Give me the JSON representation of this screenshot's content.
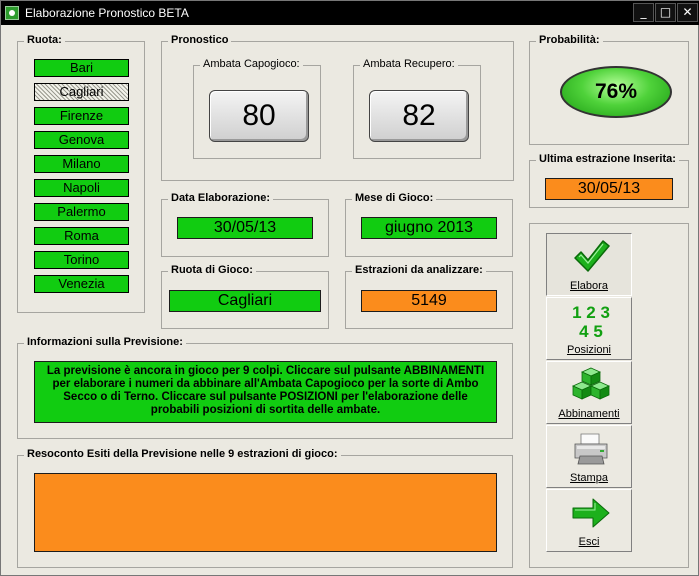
{
  "window": {
    "title": "Elaborazione Pronostico BETA",
    "minimize": "_",
    "maximize": "□",
    "close": "✕"
  },
  "ruota": {
    "legend": "Ruota:",
    "selected": "Cagliari",
    "items": [
      "Bari",
      "Cagliari",
      "Firenze",
      "Genova",
      "Milano",
      "Napoli",
      "Palermo",
      "Roma",
      "Torino",
      "Venezia"
    ]
  },
  "pronostico": {
    "legend": "Pronostico",
    "capogioco": {
      "legend": "Ambata Capogioco:",
      "value": "80"
    },
    "recupero": {
      "legend": "Ambata Recupero:",
      "value": "82"
    }
  },
  "data_elaborazione": {
    "legend": "Data Elaborazione:",
    "value": "30/05/13"
  },
  "mese_gioco": {
    "legend": "Mese di Gioco:",
    "value": "giugno 2013"
  },
  "ruota_gioco": {
    "legend": "Ruota di Gioco:",
    "value": "Cagliari"
  },
  "estrazioni": {
    "legend": "Estrazioni da analizzare:",
    "value": "5149"
  },
  "probabilita": {
    "legend": "Probabilità:",
    "value": "76%"
  },
  "ultima_estrazione": {
    "legend": "Ultima estrazione Inserita:",
    "value": "30/05/13"
  },
  "informazioni": {
    "legend": "Informazioni sulla Previsione:",
    "lines": [
      "La previsione è ancora in gioco per 9 colpi. Cliccare sul pulsante ABBINAMENTI",
      "per elaborare i numeri da abbinare all'Ambata Capogioco per la sorte di Ambo",
      "Secco o di Terno. Cliccare sul pulsante POSIZIONI per l'elaborazione delle",
      "probabili posizioni di sortita delle ambate."
    ]
  },
  "resoconto": {
    "legend": "Resoconto Esiti della Previsione nelle 9 estrazioni di gioco:",
    "value": ""
  },
  "actions": {
    "elabora": {
      "label": "Elabora",
      "icon": "checkmark-icon"
    },
    "posizioni": {
      "label": "Posizioni",
      "icon": "numbers-icon",
      "icon_text_top": "1 2 3",
      "icon_text_bottom": "4 5"
    },
    "abbinamenti": {
      "label": "Abbinamenti",
      "icon": "cubes-icon"
    },
    "stampa": {
      "label": "Stampa",
      "icon": "printer-icon"
    },
    "esci": {
      "label": "Esci",
      "icon": "arrow-right-icon"
    }
  },
  "colors": {
    "green": "#11cc11",
    "orange": "#fb8c1c",
    "window_bg": "#ebe9e1",
    "titlebar": "#000000"
  }
}
